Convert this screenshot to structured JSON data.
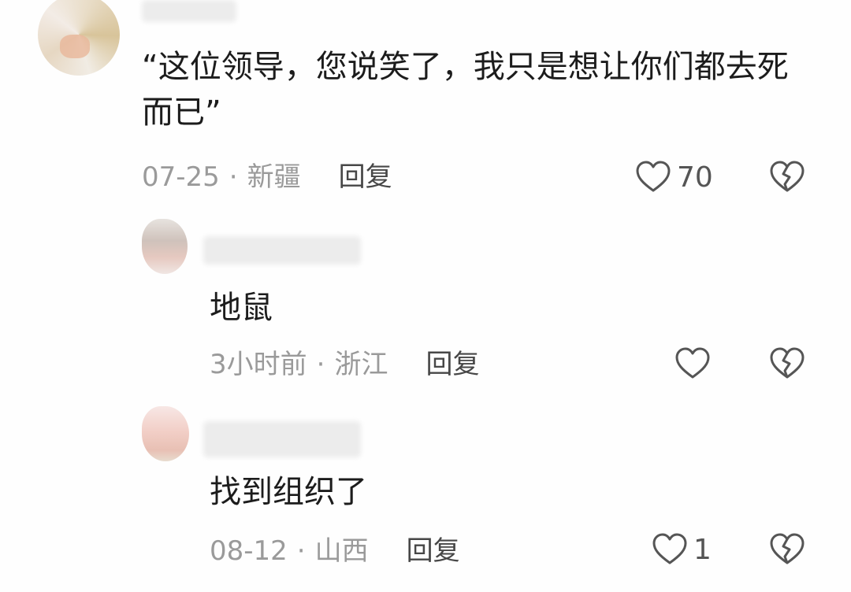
{
  "comments": [
    {
      "text": "“这位领导，您说笑了，我只是想让你们都去死而已”",
      "date": "07-25",
      "separator": "·",
      "location": "新疆",
      "reply_label": "回复",
      "like_count": "70",
      "like_icon": "heart-outline-icon",
      "dislike_icon": "broken-heart-icon"
    },
    {
      "text": "地鼠",
      "date": "3小时前",
      "separator": "·",
      "location": "浙江",
      "reply_label": "回复",
      "like_count": "",
      "like_icon": "heart-outline-icon",
      "dislike_icon": "broken-heart-icon"
    },
    {
      "text": "找到组织了",
      "date": "08-12",
      "separator": "·",
      "location": "山西",
      "reply_label": "回复",
      "like_count": "1",
      "like_icon": "heart-outline-icon",
      "dislike_icon": "broken-heart-icon"
    }
  ],
  "colors": {
    "text": "#1c1c1c",
    "meta": "#9a9a9a",
    "reply": "#474747",
    "icon": "#555555",
    "background": "#fefefe"
  }
}
